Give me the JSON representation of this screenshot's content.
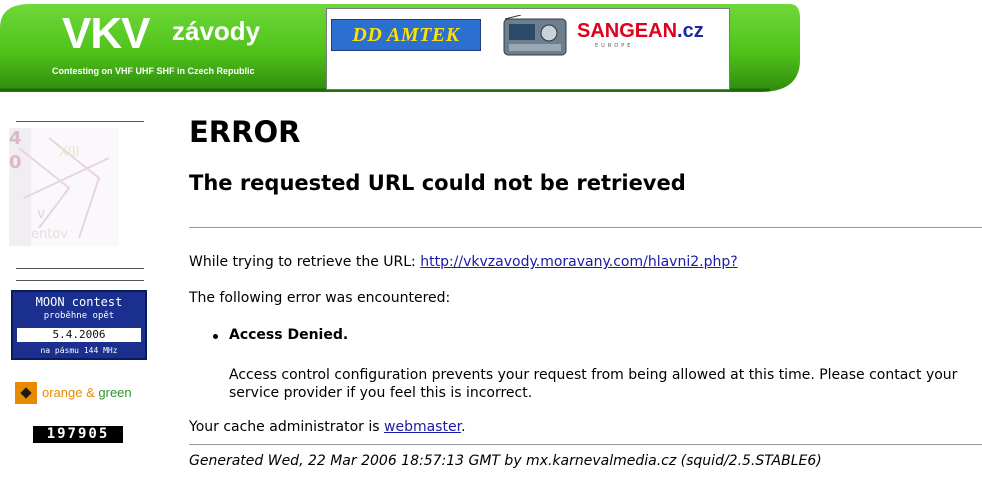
{
  "header": {
    "logo_title": "VKV",
    "logo_subtitle": "závody",
    "tagline": "Contesting on VHF UHF SHF in Czech Republic",
    "ad_amtek": "DD AMTEK",
    "ad_sangean_brand": "SANGEAN",
    "ad_sangean_tld": ".cz",
    "ad_sangean_sub": "EUROPE",
    "colors": {
      "banner_green": "#4fc21a",
      "banner_dark": "#2e8a0e",
      "ad_blue": "#2b6fd0",
      "ad_yellow": "#ffe000",
      "sangean_red": "#e0001b"
    }
  },
  "sidebar": {
    "moon_title": "MOON contest",
    "moon_sub": "proběhne opět",
    "moon_date": "5.4.2006",
    "moon_band": "na pásmu 144 MHz",
    "og_word1": "orange",
    "og_amp": " & ",
    "og_word2": "green",
    "counter": "197905",
    "colors": {
      "moon_blue": "#1a2f8e",
      "og_orange": "#e88a00",
      "og_green": "#2a9a2a"
    }
  },
  "error": {
    "title": "ERROR",
    "subtitle": "The requested URL could not be retrieved",
    "retrieve_prefix": "While trying to retrieve the URL: ",
    "url": "http://vkvzavody.moravany.com/hlavni2.php?",
    "encountered": "The following error was encountered:",
    "denied": "Access Denied.",
    "explanation": "Access control configuration prevents your request from being allowed at this time. Please contact your service provider if you feel this is incorrect.",
    "admin_prefix": "Your cache administrator is ",
    "admin_link": "webmaster",
    "admin_suffix": ".",
    "generated": "Generated Wed, 22 Mar 2006 18:57:13 GMT by mx.karnevalmedia.cz (squid/2.5.STABLE6)"
  }
}
